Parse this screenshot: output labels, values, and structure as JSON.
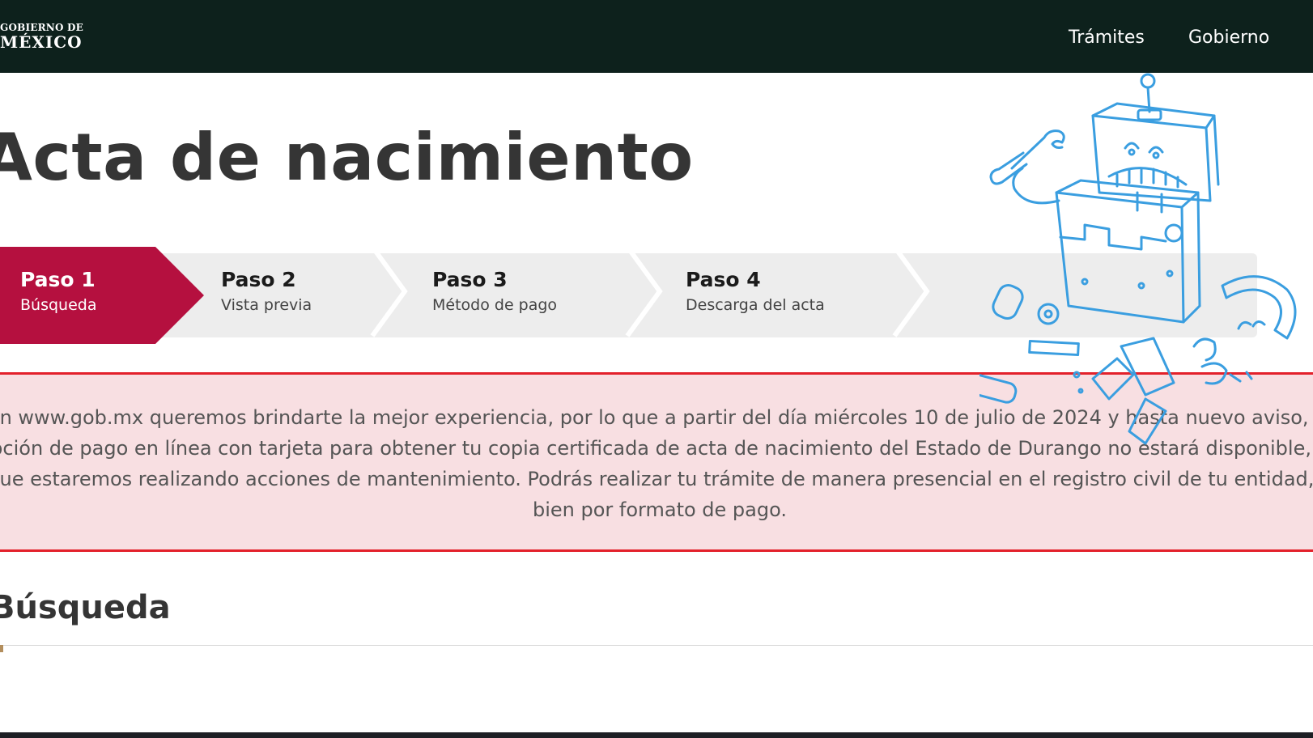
{
  "header": {
    "logo_top": "GOBIERNO DE",
    "logo_bottom": "MÉXICO",
    "nav": [
      "Trámites",
      "Gobierno"
    ]
  },
  "page_title": "Acta de nacimiento",
  "steps": [
    {
      "num": "Paso 1",
      "label": "Búsqueda",
      "active": true
    },
    {
      "num": "Paso 2",
      "label": "Vista previa"
    },
    {
      "num": "Paso 3",
      "label": "Método de pago"
    },
    {
      "num": "Paso 4",
      "label": "Descarga del acta"
    }
  ],
  "notice": "En www.gob.mx queremos brindarte la mejor experiencia, por lo que a partir del día miércoles 10 de julio de 2024 y hasta nuevo aviso, la opción de pago en línea con tarjeta para obtener tu copia certificada de acta de nacimiento del Estado de Durango no estará disponible, ya que estaremos realizando acciones de mantenimiento. Podrás realizar tu trámite de manera presencial en el registro civil de tu entidad, o bien por formato de pago.",
  "section_title": "Búsqueda",
  "colors": {
    "header_bg": "#0d211c",
    "active_step": "#b5103f",
    "alert_bg": "#f8dfe2",
    "alert_border": "#e3212b",
    "robot_sketch": "#3a9ee0"
  },
  "icons": {
    "robot": "robot-repair-sketch-icon"
  }
}
